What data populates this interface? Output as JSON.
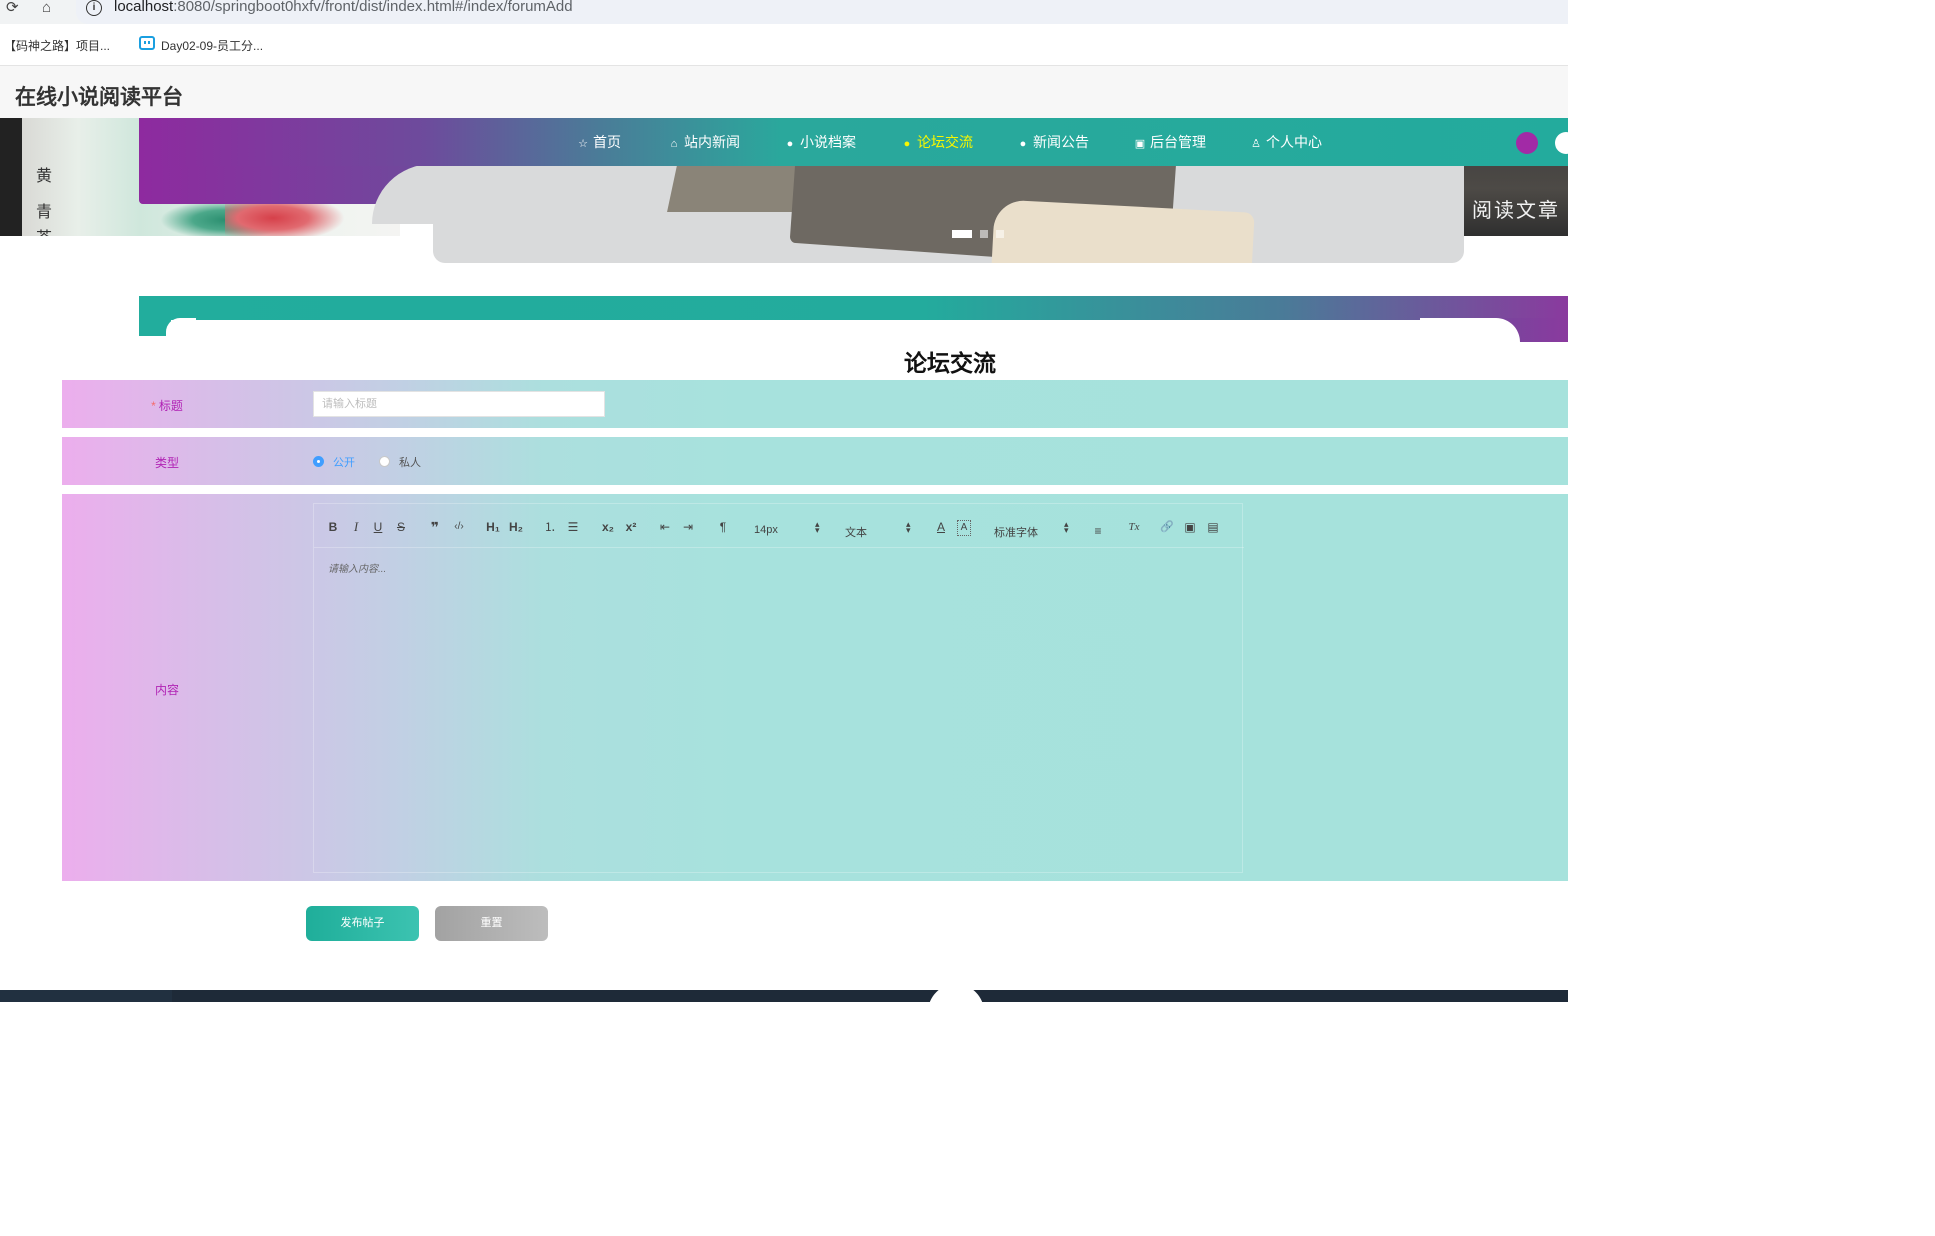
{
  "browser": {
    "url_host": "localhost",
    "url_path": ":8080/springboot0hxfv/front/dist/index.html#/index/forumAdd",
    "reload_icon": "reload-icon",
    "home_icon": "home-icon",
    "info_icon": "info-icon",
    "bookmarks": [
      {
        "label": "【码神之路】项目..."
      },
      {
        "label": "Day02-09-员工分..."
      }
    ]
  },
  "site": {
    "title": "在线小说阅读平台"
  },
  "banner": {
    "left_text": [
      "黄",
      "青",
      "茶"
    ],
    "right_text": "阅读文章",
    "carousel_slides": 3,
    "carousel_active": 1
  },
  "nav": {
    "items": [
      {
        "label": "首页",
        "icon": "star-icon",
        "active": false
      },
      {
        "label": "站内新闻",
        "icon": "home-icon",
        "active": false
      },
      {
        "label": "小说档案",
        "icon": "info-icon",
        "active": false
      },
      {
        "label": "论坛交流",
        "icon": "info-icon",
        "active": true
      },
      {
        "label": "新闻公告",
        "icon": "info-icon",
        "active": false
      },
      {
        "label": "后台管理",
        "icon": "bag-icon",
        "active": false
      },
      {
        "label": "个人中心",
        "icon": "user-icon",
        "active": false
      }
    ],
    "active_color": "#f7f700"
  },
  "form": {
    "title": "论坛交流",
    "title_field": {
      "required_mark": "*",
      "label": "标题",
      "value": "",
      "placeholder": "请输入标题"
    },
    "type_field": {
      "label": "类型",
      "options": [
        "公开",
        "私人"
      ],
      "selected": "公开"
    },
    "content_field": {
      "label": "内容",
      "placeholder": "请输入内容...",
      "toolbar": {
        "bold": "B",
        "italic": "I",
        "underline": "U",
        "strike": "S",
        "blockquote": "❞",
        "code": "‹/›",
        "h1": "H₁",
        "h2": "H₂",
        "ordered_list": "⒈",
        "bullet_list": "☰",
        "subscript": "x₂",
        "superscript": "x²",
        "outdent": "⇤",
        "indent": "⇥",
        "direction": "¶",
        "size_value": "14px",
        "header_value": "文本",
        "font_value": "标准字体",
        "color": "A",
        "background": "A",
        "align": "≡",
        "clean": "Tx",
        "link": "🔗",
        "image": "▣",
        "video": "▤"
      }
    },
    "submit_label": "发布帖子",
    "reset_label": "重置"
  },
  "colors": {
    "accent_purple": "#8e2a9f",
    "accent_teal": "#23ab9d",
    "label_color": "#b123b5",
    "radio_active": "#409eff"
  }
}
